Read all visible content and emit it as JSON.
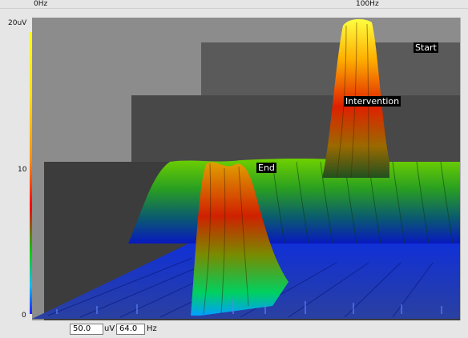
{
  "ruler": {
    "start_label": "0Hz",
    "mid_label": "100Hz"
  },
  "yaxis": {
    "top_label": "20uV",
    "mid_label": "10",
    "bottom_label": "0"
  },
  "markers": {
    "start": "Start",
    "intervention": "Intervention",
    "end": "End"
  },
  "controls": {
    "amplitude_value": "50.0",
    "amplitude_unit": "uV",
    "freq_value": "64.0",
    "freq_unit": "Hz"
  },
  "colors": {
    "plot_bg": "#888888",
    "accent_high": "#ffff00",
    "accent_low": "#1020d0"
  }
}
